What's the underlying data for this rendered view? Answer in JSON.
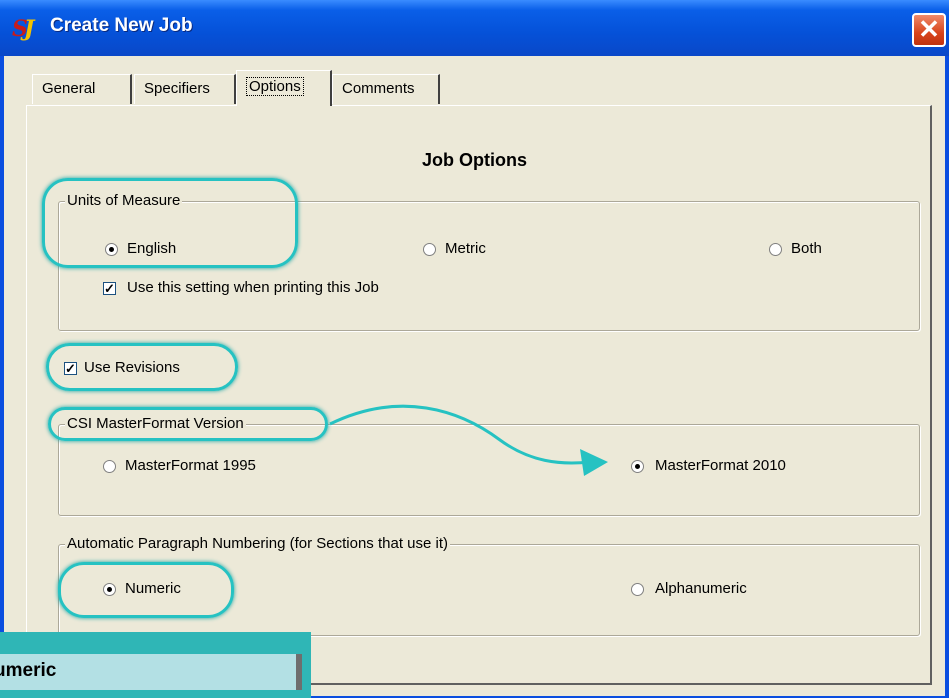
{
  "window": {
    "title": "Create New Job",
    "close_label": "✕"
  },
  "tabs": [
    {
      "label": "General"
    },
    {
      "label": "Specifiers"
    },
    {
      "label": "Options"
    },
    {
      "label": "Comments"
    }
  ],
  "heading": "Job Options",
  "units": {
    "group_label": "Units of Measure",
    "options": [
      {
        "label": "English",
        "selected": true
      },
      {
        "label": "Metric",
        "selected": false
      },
      {
        "label": "Both",
        "selected": false
      }
    ],
    "print_setting_label": "Use this setting when printing this Job",
    "print_setting_checked": true
  },
  "revisions": {
    "label": "Use Revisions",
    "checked": true
  },
  "csi": {
    "group_label": "CSI MasterFormat Version",
    "options": [
      {
        "label": "MasterFormat 1995",
        "selected": false
      },
      {
        "label": "MasterFormat 2010",
        "selected": true
      }
    ]
  },
  "numbering": {
    "group_label": "Automatic Paragraph Numbering (for Sections that use it)",
    "options": [
      {
        "label": "Numeric",
        "selected": true
      },
      {
        "label": "Alphanumeric",
        "selected": false
      }
    ]
  },
  "callout": {
    "text": "umeric"
  },
  "colors": {
    "highlight": "#26c2c2",
    "titlebar": "#0551d8",
    "dialog": "#ece9d8"
  }
}
